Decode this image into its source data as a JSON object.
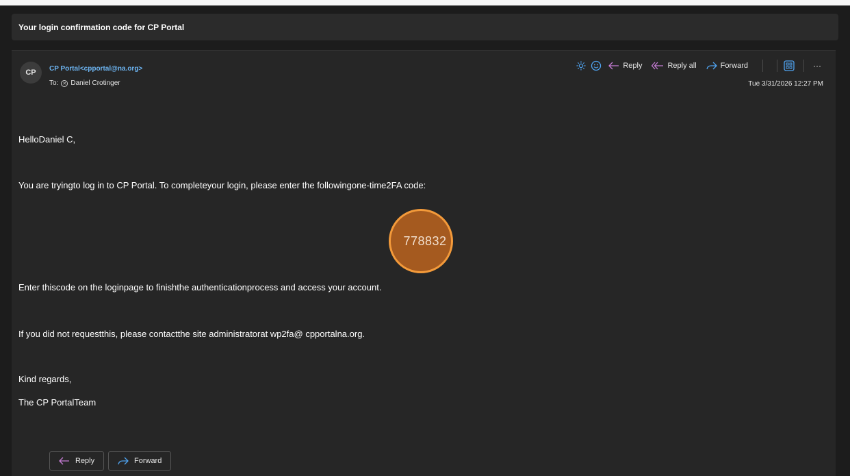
{
  "subject": "Your login confirmation code for CP Portal",
  "header": {
    "avatar_initials": "CP",
    "sender": "CP Portal<cpportal@na.org>",
    "to_prefix": "To:",
    "recipient": "Daniel Crotinger",
    "timestamp": "Tue 3/31/2026 12:27 PM"
  },
  "actions": {
    "reply": "Reply",
    "reply_all": "Reply all",
    "forward": "Forward",
    "more": "···"
  },
  "body": {
    "greeting": "HelloDaniel C,",
    "line1": "You are tryingto log in to CP Portal. To completeyour login, please enter the followingone-time2FA code:",
    "code": "778832",
    "line2": "Enter thiscode on the loginpage to finishthe authenticationprocess and access your account.",
    "line3": "If you did not requestthis, please contactthe site administratorat wp2fa@ cpportalna.org.",
    "signoff": "Kind regards,",
    "signature": "The CP PortalTeam"
  },
  "footer": {
    "reply": "Reply",
    "forward": "Forward"
  },
  "colors": {
    "background": "#1c1c1c",
    "panel": "#262626",
    "link": "#6db5f2",
    "highlight": "#a55a1f",
    "highlight_border": "#f39a3a",
    "reply_all_icon": "#c77dd6",
    "icon_blue": "#4fa3f0"
  }
}
